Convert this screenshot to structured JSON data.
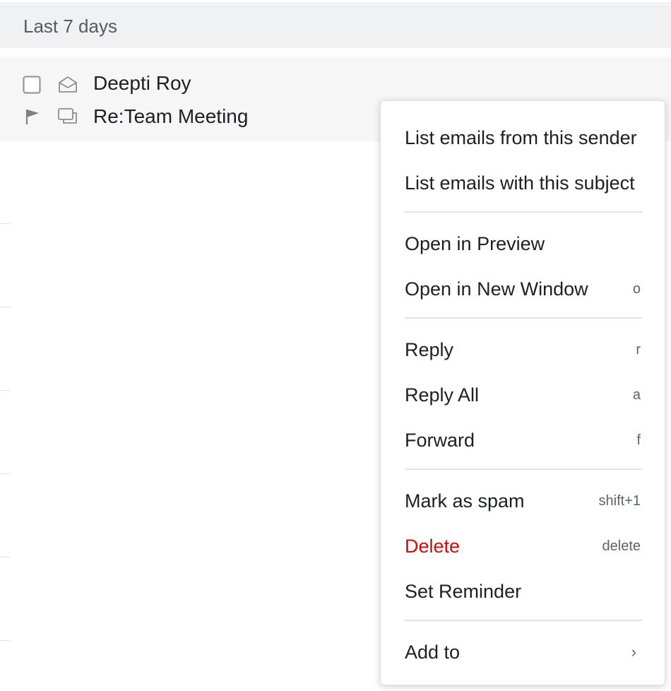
{
  "group": {
    "label": "Last 7 days"
  },
  "mail": {
    "sender": "Deepti Roy",
    "subject": "Re:Team Meeting"
  },
  "menu": {
    "items": [
      {
        "label": "List emails from this sender",
        "shortcut": ""
      },
      {
        "label": "List emails with this subject",
        "shortcut": ""
      },
      {
        "label": "Open in Preview",
        "shortcut": ""
      },
      {
        "label": "Open in New Window",
        "shortcut": "o"
      },
      {
        "label": "Reply",
        "shortcut": "r"
      },
      {
        "label": "Reply All",
        "shortcut": "a"
      },
      {
        "label": "Forward",
        "shortcut": "f"
      },
      {
        "label": "Mark as spam",
        "shortcut": "shift+1"
      },
      {
        "label": "Delete",
        "shortcut": "delete"
      },
      {
        "label": "Set Reminder",
        "shortcut": ""
      },
      {
        "label": "Add to",
        "shortcut": ""
      }
    ],
    "submenu_arrow": "›"
  },
  "icons": {
    "checkbox": "checkbox-icon",
    "envelope_open": "envelope-open-icon",
    "flag": "flag-icon",
    "conversation": "conversation-icon",
    "chevron_right": "chevron-right-icon"
  },
  "colors": {
    "danger": "#d30a0a",
    "header_bg": "#f0f1f3",
    "row_bg": "#f6f6f7",
    "text": "#1d1f22",
    "muted": "#5e6369"
  }
}
